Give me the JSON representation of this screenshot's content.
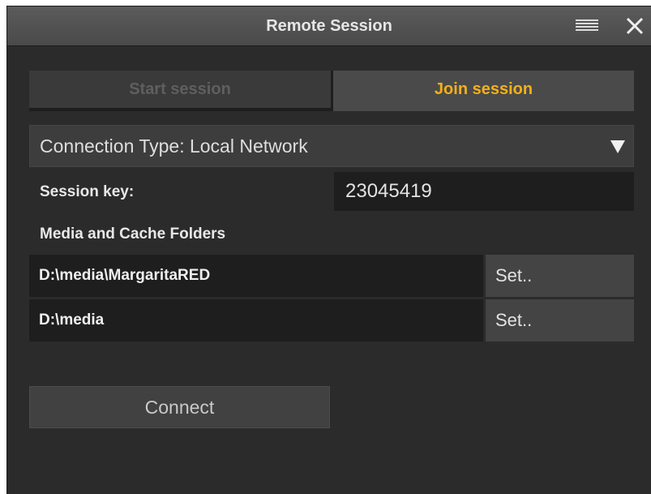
{
  "window": {
    "title": "Remote Session"
  },
  "tabs": [
    {
      "label": "Start session",
      "active": false
    },
    {
      "label": "Join session",
      "active": true
    }
  ],
  "connection": {
    "label": "Connection Type: Local Network"
  },
  "session_key": {
    "label": "Session key:",
    "value": "23045419"
  },
  "folders": {
    "heading": "Media and Cache Folders",
    "rows": [
      {
        "path": "D:\\media\\MargaritaRED",
        "button": "Set.."
      },
      {
        "path": "D:\\media",
        "button": "Set.."
      }
    ]
  },
  "actions": {
    "connect_label": "Connect"
  },
  "colors": {
    "accent": "#f3b019",
    "background": "#2b2b2b",
    "titlebar": "#525252"
  },
  "icons": {
    "menu": "hamburger-menu-icon",
    "close": "close-icon",
    "dropdown": "triangle-down-icon"
  }
}
